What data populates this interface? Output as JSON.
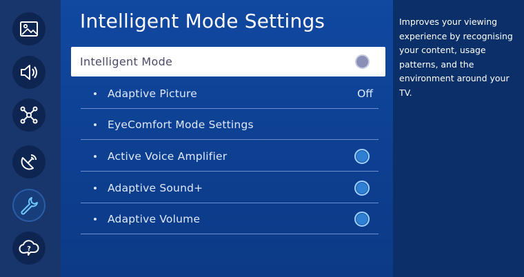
{
  "page": {
    "title": "Intelligent Mode Settings"
  },
  "sidebar": {
    "items": [
      {
        "name": "picture",
        "icon": "picture-icon"
      },
      {
        "name": "sound",
        "icon": "speaker-icon"
      },
      {
        "name": "connection",
        "icon": "network-icon"
      },
      {
        "name": "broadcasting",
        "icon": "satellite-dish-icon"
      },
      {
        "name": "general",
        "icon": "wrench-icon",
        "active": true
      },
      {
        "name": "support",
        "icon": "help-cloud-icon"
      }
    ]
  },
  "menu": {
    "focused": {
      "label": "Intelligent Mode",
      "toggle": "on"
    },
    "items": [
      {
        "label": "Adaptive Picture",
        "value": "Off"
      },
      {
        "label": "EyeComfort Mode Settings"
      },
      {
        "label": "Active Voice Amplifier",
        "toggle": "on"
      },
      {
        "label": "Adaptive Sound+",
        "toggle": "on"
      },
      {
        "label": "Adaptive Volume",
        "toggle": "on"
      }
    ]
  },
  "description": {
    "text": "Improves your viewing experience by recognising your content, usage patterns, and the environment around your TV."
  },
  "colors": {
    "main_bg": "#0e3f8c",
    "rail_bg": "#18366b",
    "desc_bg": "#0b2f68",
    "toggle_on": "#2f7fd2"
  }
}
